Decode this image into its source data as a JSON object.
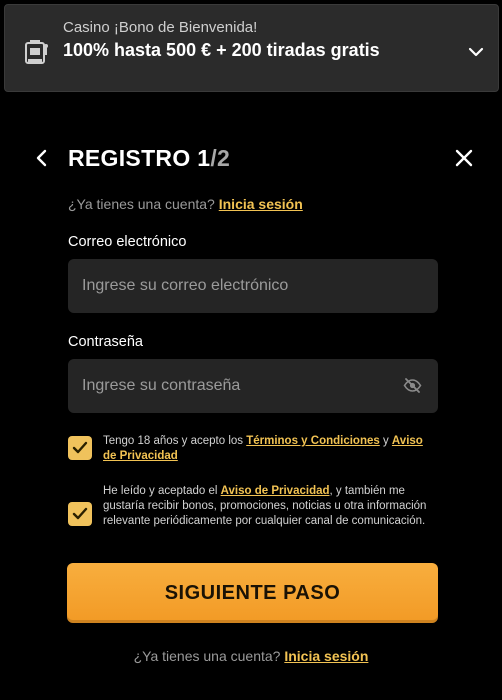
{
  "banner": {
    "kicker": "Casino ¡Bono de Bienvenida!",
    "title": "100% hasta 500 € + 200 tiradas gratis",
    "icon": "slot-machine-icon"
  },
  "header": {
    "title": "REGISTRO ",
    "step_current": "1",
    "step_total": "/2"
  },
  "login_prompt": {
    "text": "¿Ya tienes una cuenta?",
    "link": "Inicia sesión"
  },
  "form": {
    "email_label": "Correo electrónico",
    "email_placeholder": "Ingrese su correo electrónico",
    "email_value": "",
    "password_label": "Contraseña",
    "password_placeholder": "Ingrese su contraseña",
    "password_value": ""
  },
  "consents": [
    {
      "checked": true,
      "text_a": "Tengo 18 años y acepto los ",
      "link_a": "Términos y Condiciones",
      "text_b": " y ",
      "link_b": "Aviso de Privacidad",
      "text_c": ""
    },
    {
      "checked": true,
      "text_a": "He leído y aceptado el ",
      "link_a": "Aviso de Privacidad",
      "text_b": ", y también me gustaría recibir bonos, promociones, noticias u otra información relevante periódicamente por cualquier canal de comunicación."
    }
  ],
  "next_button": "SIGUIENTE PASO",
  "bottom_prompt": {
    "text": "¿Ya tienes una cuenta? ",
    "link": "Inicia sesión"
  },
  "colors": {
    "background": "#000000",
    "accent": "#f2c353",
    "button": "#f29a25",
    "field": "#252525"
  }
}
